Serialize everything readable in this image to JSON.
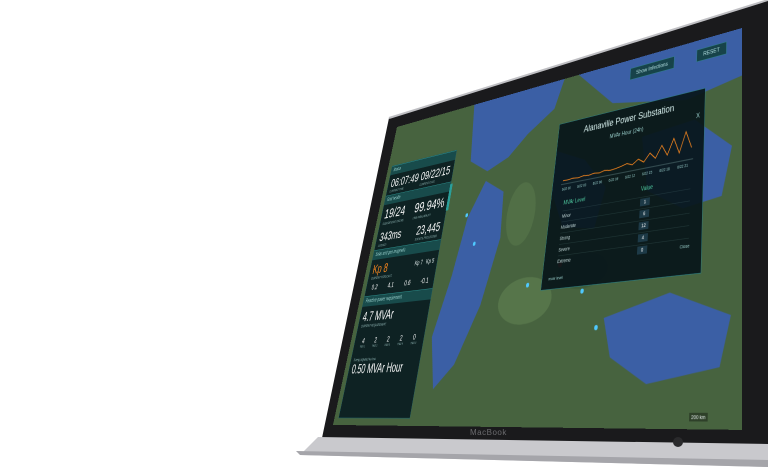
{
  "device": {
    "brand": "MacBook"
  },
  "top_buttons": [
    {
      "label": "Show Infections"
    },
    {
      "label": "RESET"
    }
  ],
  "colors": {
    "accent": "#2a9f9a",
    "orange": "#ff8a1e",
    "panel_bg": "#0a1c21",
    "water": "#3b5fa5",
    "land": "#4b6a45"
  },
  "panel": {
    "section1": {
      "label": "Status",
      "time": "06:07:49",
      "date": "09/22/15",
      "time_caption": "CURRENT TIME",
      "date_caption": "CURRENT DATE"
    },
    "section2": {
      "label": "Grid health",
      "stat1": "19/24",
      "stat1_caption": "SUBSTATIONS ONLINE",
      "stat2": "99.94%",
      "stat2_caption": "LINE AVAILABILITY",
      "stat3": "343ms",
      "stat3_caption": "LATENCY",
      "stat4": "23,445",
      "stat4_caption": "EVENTS PROCESSED"
    },
    "section3": {
      "label": "Solar and geo-magnetic",
      "kp": "Kp 8",
      "kp_caption": "CURRENT FORECAST",
      "b1": "Kp 7",
      "b2": "Kp 5",
      "c1": "0.2",
      "c2": "4.1",
      "c3": "0.6",
      "c4": "-0.1"
    },
    "section4": {
      "label": "Reactive power requirement",
      "mvar": "4.7 MVAr",
      "mvar_caption": "CURRENT REQUIREMENT",
      "minis": [
        {
          "v": "4",
          "l": "TIER 1"
        },
        {
          "v": "2",
          "l": "TIER 2"
        },
        {
          "v": "2",
          "l": "TIER 3"
        },
        {
          "v": "2",
          "l": "TIER 4"
        },
        {
          "v": "0",
          "l": "TIER 5"
        }
      ]
    },
    "section5": {
      "caption": "Energy adjusted by hour",
      "value": "0.50 MVAr Hour"
    }
  },
  "popup": {
    "title": "Alanaville Power Substation",
    "subtitle": "MVAr Hour (24h)",
    "close": "X",
    "table_head_left": "MVAr Level",
    "table_head_right": "Value",
    "rows": [
      {
        "name": "Minor",
        "value": "1"
      },
      {
        "name": "Moderate",
        "value": "6"
      },
      {
        "name": "Strong",
        "value": "12"
      },
      {
        "name": "Severe",
        "value": "4"
      },
      {
        "name": "Extreme",
        "value": "0"
      }
    ],
    "legend": "mvar level",
    "close_label": "Close"
  },
  "chart_data": {
    "type": "line",
    "title": "MVAr Hour (24h)",
    "x": [
      "6/22 00",
      "6/22 03",
      "6/22 06",
      "6/22 09",
      "6/22 12",
      "6/22 15",
      "6/22 18",
      "6/22 21"
    ],
    "series": [
      {
        "values": [
          1,
          1,
          1.2,
          1,
          1.3,
          1.1,
          1.4,
          1.2,
          1.6,
          1.3,
          1.5,
          1.8,
          2.2,
          1.6,
          2.8,
          1.7,
          3.8,
          2.1,
          5.2,
          2.3,
          6.4,
          2.2,
          7.5,
          3.0
        ]
      }
    ],
    "ylim": [
      0,
      8
    ]
  },
  "map": {
    "scale_label": "200 km"
  }
}
